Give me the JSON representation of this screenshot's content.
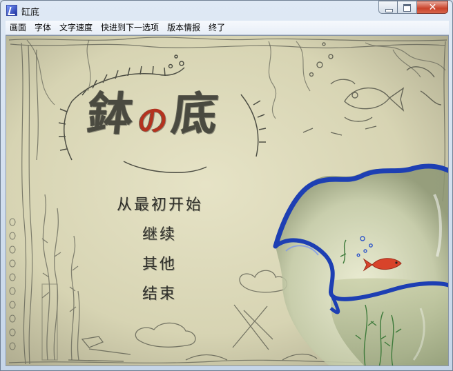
{
  "window": {
    "title": "缸底",
    "close_glyph": "✕"
  },
  "menubar": {
    "items": [
      "画面",
      "字体",
      "文字速度",
      "快进到下一选项",
      "版本情报",
      "终了"
    ]
  },
  "title_screen": {
    "logo": {
      "char1": "鉢",
      "char2": "の",
      "char3": "底"
    },
    "options": [
      "从最初开始",
      "继续",
      "其他",
      "结束"
    ]
  },
  "colors": {
    "paper": "#d9d6b6",
    "pencil": "#55564c",
    "bowl_rim": "#1d3fb3",
    "fish": "#d8432a"
  }
}
